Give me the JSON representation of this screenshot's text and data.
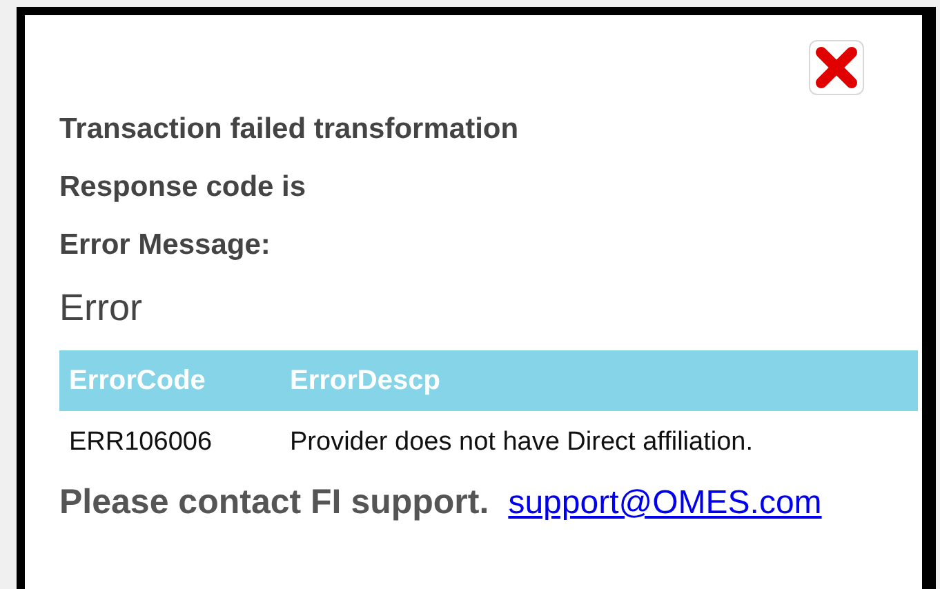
{
  "messages": [
    "Transaction failed transformation",
    "Response code is",
    "Error Message:"
  ],
  "heading": "Error",
  "table": {
    "columns": [
      "ErrorCode",
      "ErrorDescp"
    ],
    "rows": [
      [
        "ERR106006",
        "Provider does not have Direct affiliation."
      ]
    ]
  },
  "footer": {
    "text": "Please contact FI support.",
    "link": "support@OMES.com"
  }
}
